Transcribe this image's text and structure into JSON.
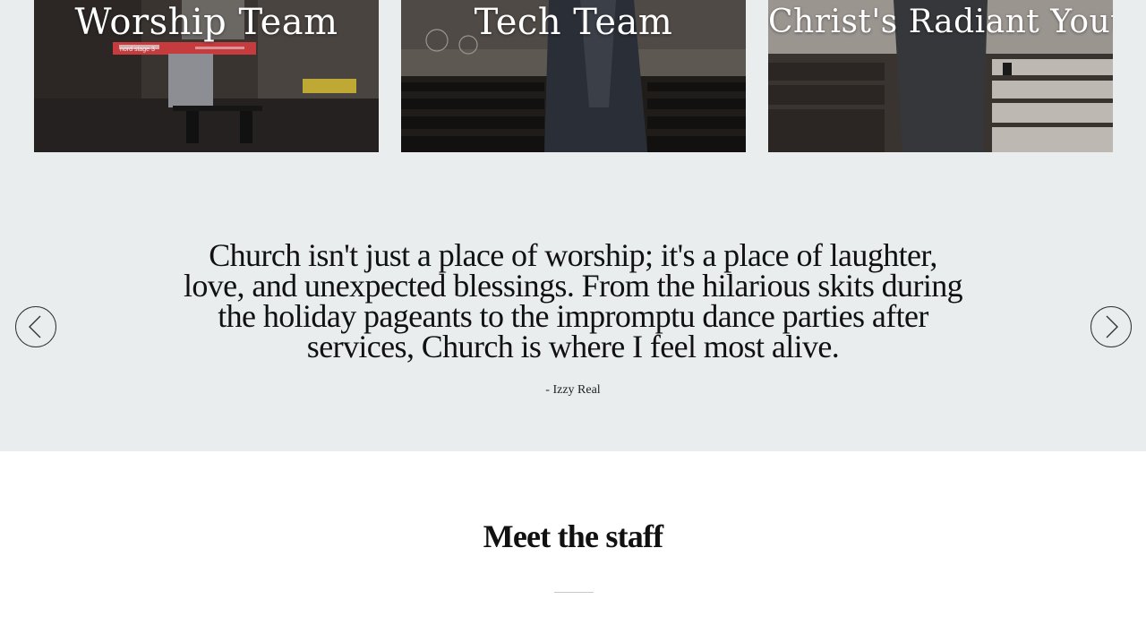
{
  "teams": [
    {
      "title": "Worship Team"
    },
    {
      "title": "Tech Team"
    },
    {
      "title": "Christ's Radiant Youth"
    }
  ],
  "keyboard_brand": "nord stage 3",
  "testimonial": {
    "quote": "Church isn't just a place of worship; it's a place of laughter, love, and unexpected blessings. From the hilarious skits during the holiday pageants to the impromptu dance parties after services, Church is where I feel most alive.",
    "author": "- Izzy Real"
  },
  "carousel": {
    "prev_icon": "chevron-left-icon",
    "next_icon": "chevron-right-icon"
  },
  "staff": {
    "title": "Meet the staff"
  },
  "colors": {
    "band_background": "#e9edee",
    "text": "#111111",
    "card_title": "#ffffff",
    "keyboard_red": "#c63b3d"
  }
}
